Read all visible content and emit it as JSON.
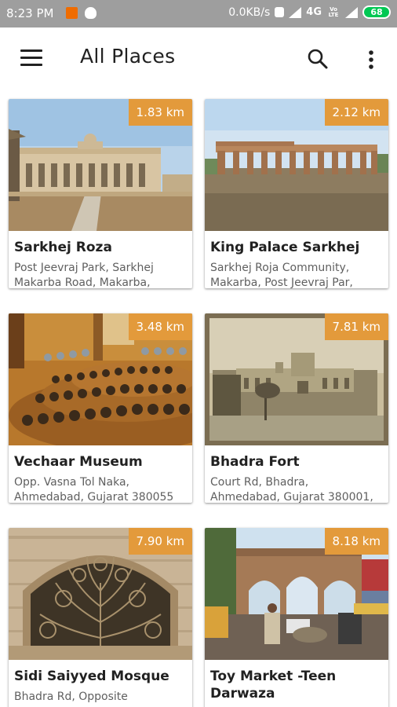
{
  "status_bar": {
    "time": "8:23 PM",
    "network_speed": "0.0KB/s",
    "network_type": "4G",
    "volte_label": "Vo LTE",
    "battery_level": "68"
  },
  "app_bar": {
    "title": "All Places",
    "menu_icon": "hamburger-menu-icon",
    "search_icon": "search-icon",
    "more_icon": "more-vert-icon"
  },
  "colors": {
    "distance_badge": "#e39a3b",
    "status_bar_bg": "#9e9e9e",
    "battery": "#00c853"
  },
  "places": [
    {
      "name": "Sarkhej Roza",
      "distance": "1.83 km",
      "address_line1": "Post Jeevraj Park, Sarkhej",
      "address_line2": "Makarba Road, Makarba,"
    },
    {
      "name": "King Palace Sarkhej",
      "distance": "2.12 km",
      "address_line1": "Sarkhej Roja Community,",
      "address_line2": "Makarba, Post Jeevraj Par,"
    },
    {
      "name": "Vechaar Museum",
      "distance": "3.48 km",
      "address_line1": "Opp. Vasna Tol Naka,",
      "address_line2": "Ahmedabad, Gujarat 380055"
    },
    {
      "name": "Bhadra Fort",
      "distance": "7.81 km",
      "address_line1": "Court Rd, Bhadra,",
      "address_line2": "Ahmedabad, Gujarat 380001,"
    },
    {
      "name": "Sidi Saiyyed Mosque",
      "distance": "7.90 km",
      "address_line1": "Bhadra Rd, Opposite",
      "address_line2": ""
    },
    {
      "name": "Toy Market -Teen Darwaza",
      "distance": "8.18 km",
      "address_line1": "",
      "address_line2": ""
    }
  ]
}
